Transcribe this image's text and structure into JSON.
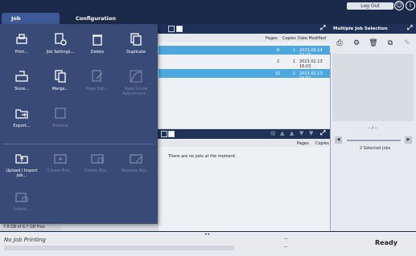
{
  "header": {
    "logout_label": "Log Out",
    "icons": [
      "user-icon",
      "info-icon"
    ]
  },
  "tabs": [
    {
      "label": "Job Management",
      "active": true
    },
    {
      "label": "Configuration",
      "active": false
    }
  ],
  "menu": {
    "items": [
      {
        "label": "Print...",
        "enabled": true,
        "icon": "print-icon"
      },
      {
        "label": "Job Settings...",
        "enabled": true,
        "icon": "job-settings-icon"
      },
      {
        "label": "Delete",
        "enabled": true,
        "icon": "trash-icon"
      },
      {
        "label": "Duplicate",
        "enabled": true,
        "icon": "duplicate-icon"
      },
      {
        "label": "Store...",
        "enabled": true,
        "icon": "store-icon"
      },
      {
        "label": "Merge...",
        "enabled": true,
        "icon": "merge-icon"
      },
      {
        "label": "Page Edit...",
        "enabled": false,
        "icon": "page-edit-icon"
      },
      {
        "label": "Save Curve Adjustment...",
        "enabled": false,
        "icon": "curve-adjust-icon"
      },
      {
        "label": "Export...",
        "enabled": true,
        "icon": "export-icon"
      },
      {
        "label": "Preview",
        "enabled": false,
        "icon": "preview-icon"
      },
      {
        "label": "Upload / Import Job...",
        "enabled": true,
        "icon": "upload-icon"
      },
      {
        "label": "Create Box...",
        "enabled": false,
        "icon": "create-box-icon"
      },
      {
        "label": "Delete Box...",
        "enabled": false,
        "icon": "delete-box-icon"
      },
      {
        "label": "Rename Box...",
        "enabled": false,
        "icon": "rename-box-icon"
      },
      {
        "label": "Unlock...",
        "enabled": false,
        "icon": "unlock-icon"
      }
    ]
  },
  "job_list": {
    "columns": [
      "Pages",
      "Copies",
      "Date Modified"
    ],
    "rows": [
      {
        "pages": "6",
        "copies": "1",
        "date": "2023.03.14 13:23",
        "selected": true
      },
      {
        "pages": "2",
        "copies": "1",
        "date": "2023.02.13 16:03",
        "selected": false
      },
      {
        "pages": "32",
        "copies": "1",
        "date": "2023.02.13 16:01",
        "selected": true
      }
    ]
  },
  "queue_list": {
    "columns": [
      "Pages",
      "Copies"
    ],
    "empty_message": "There are no jobs at the moment."
  },
  "storage": {
    "text": "7.6 GB of 8.7 GB Free"
  },
  "multi_selection": {
    "title": "Multiple Job Selection",
    "pager": "-- / --",
    "selected_text": "2 Selected Jobs"
  },
  "status_bar": {
    "printing": "No Job Printing",
    "status": "Ready",
    "dash1": "--",
    "dash2": "--"
  },
  "colors": {
    "menu_bg": "#384a75",
    "header_bg": "#1b2a4a",
    "selected_row": "#4ea8e0"
  }
}
